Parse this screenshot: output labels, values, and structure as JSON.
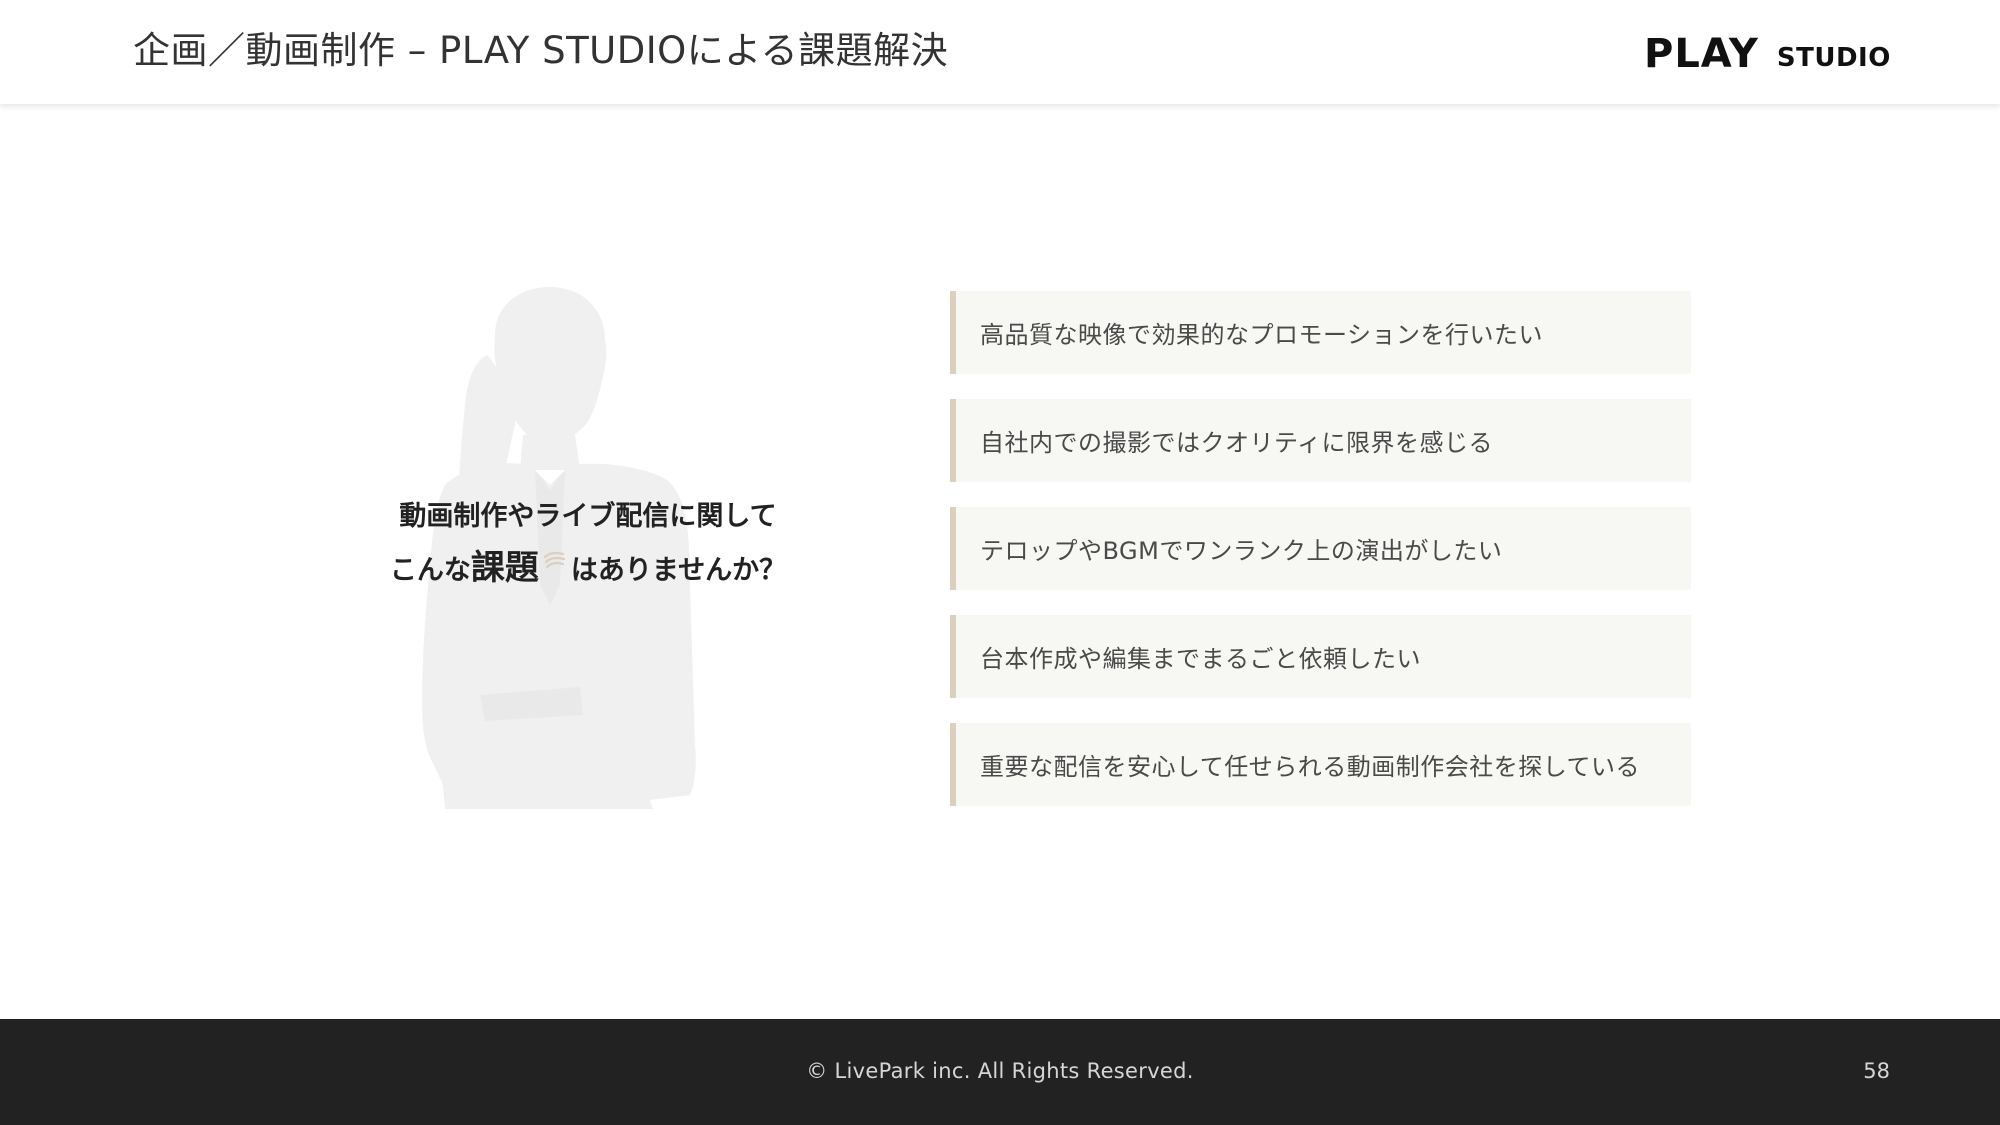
{
  "header": {
    "title": "企画／動画制作 – PLAY STUDIOによる課題解決",
    "logo": {
      "primary": "PLAY",
      "secondary": "STUDIO"
    }
  },
  "lead": {
    "line1": "動画制作やライブ配信に関して",
    "line2_prefix": "こんな",
    "line2_emphasis": "課題",
    "line2_suffix": "はありませんか？",
    "emphasis_icon": "wave-icon"
  },
  "issues": [
    "高品質な映像で効果的なプロモーションを行いたい",
    "自社内での撮影ではクオリティに限界を感じる",
    "テロップやBGMでワンランク上の演出がしたい",
    "台本作成や編集までまるごと依頼したい",
    "重要な配信を安心して任せられる動画制作会社を探している"
  ],
  "footer": {
    "copyright": "© LivePark inc. All Rights Reserved.",
    "page_number": "58"
  },
  "colors": {
    "accent": "#dccfbf",
    "card_background": "#f7f7f4",
    "footer_background": "#222222",
    "silhouette": "#f0f0f0"
  }
}
